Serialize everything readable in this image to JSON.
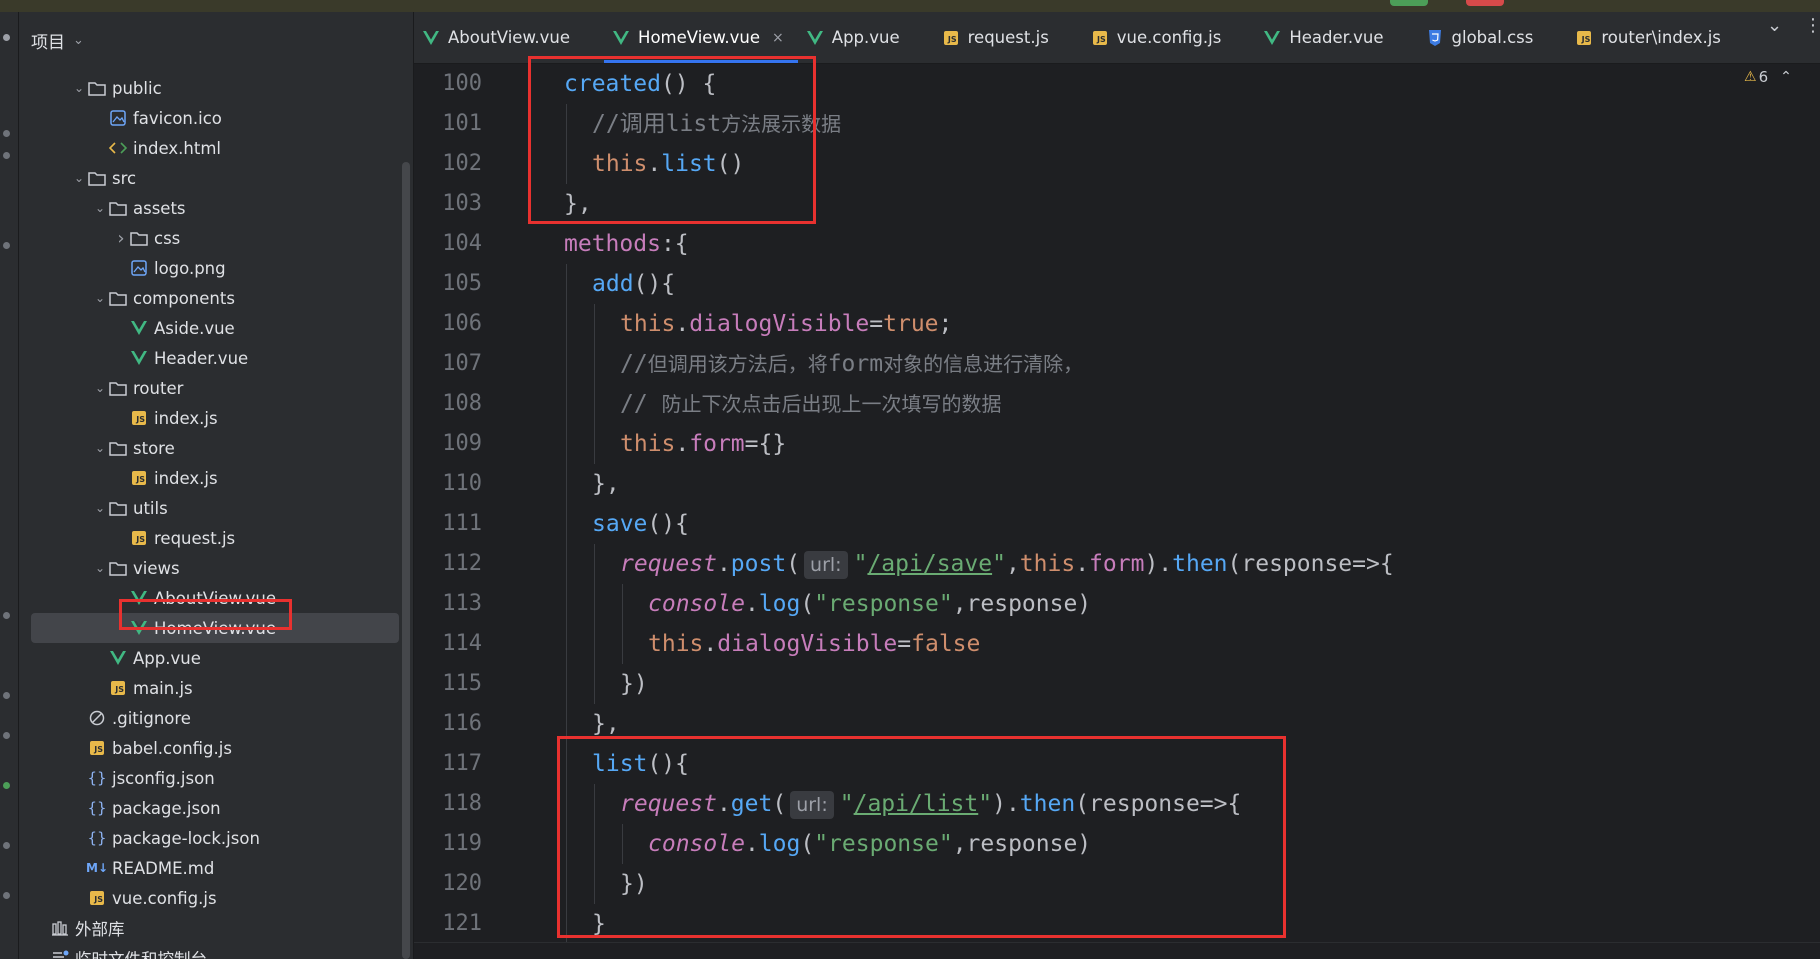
{
  "project": {
    "header_label": "项目",
    "tree": [
      {
        "label": "public",
        "type": "folder",
        "depth": 1,
        "expanded": true
      },
      {
        "label": "favicon.ico",
        "type": "image",
        "depth": 2
      },
      {
        "label": "index.html",
        "type": "html",
        "depth": 2
      },
      {
        "label": "src",
        "type": "folder",
        "depth": 1,
        "expanded": true
      },
      {
        "label": "assets",
        "type": "folder",
        "depth": 2,
        "expanded": true
      },
      {
        "label": "css",
        "type": "folder",
        "depth": 3,
        "expanded": false
      },
      {
        "label": "logo.png",
        "type": "image",
        "depth": 3
      },
      {
        "label": "components",
        "type": "folder",
        "depth": 2,
        "expanded": true
      },
      {
        "label": "Aside.vue",
        "type": "vue",
        "depth": 3
      },
      {
        "label": "Header.vue",
        "type": "vue",
        "depth": 3
      },
      {
        "label": "router",
        "type": "folder",
        "depth": 2,
        "expanded": true
      },
      {
        "label": "index.js",
        "type": "js",
        "depth": 3
      },
      {
        "label": "store",
        "type": "folder",
        "depth": 2,
        "expanded": true
      },
      {
        "label": "index.js",
        "type": "js",
        "depth": 3
      },
      {
        "label": "utils",
        "type": "folder",
        "depth": 2,
        "expanded": true
      },
      {
        "label": "request.js",
        "type": "js",
        "depth": 3
      },
      {
        "label": "views",
        "type": "folder",
        "depth": 2,
        "expanded": true
      },
      {
        "label": "AboutView.vue",
        "type": "vue",
        "depth": 3
      },
      {
        "label": "HomeView.vue",
        "type": "vue",
        "depth": 3,
        "selected": true
      },
      {
        "label": "App.vue",
        "type": "vue",
        "depth": 2
      },
      {
        "label": "main.js",
        "type": "js",
        "depth": 2
      },
      {
        "label": ".gitignore",
        "type": "ignore",
        "depth": 1
      },
      {
        "label": "babel.config.js",
        "type": "js",
        "depth": 1
      },
      {
        "label": "jsconfig.json",
        "type": "json",
        "depth": 1
      },
      {
        "label": "package.json",
        "type": "json",
        "depth": 1
      },
      {
        "label": "package-lock.json",
        "type": "json",
        "depth": 1
      },
      {
        "label": "README.md",
        "type": "md",
        "depth": 1
      },
      {
        "label": "vue.config.js",
        "type": "js",
        "depth": 1
      },
      {
        "label": "外部库",
        "type": "library",
        "depth": 0
      },
      {
        "label": "临时文件和控制台",
        "type": "scratch",
        "depth": 0
      }
    ]
  },
  "tabs": [
    {
      "label": "AboutView.vue",
      "type": "vue",
      "active": false
    },
    {
      "label": "HomeView.vue",
      "type": "vue",
      "active": true
    },
    {
      "label": "App.vue",
      "type": "vue",
      "active": false
    },
    {
      "label": "request.js",
      "type": "js",
      "active": false
    },
    {
      "label": "vue.config.js",
      "type": "js",
      "active": false
    },
    {
      "label": "Header.vue",
      "type": "vue",
      "active": false
    },
    {
      "label": "global.css",
      "type": "css",
      "active": false
    },
    {
      "label": "router\\index.js",
      "type": "js",
      "active": false
    }
  ],
  "editor": {
    "warnings_count": "6",
    "lines": [
      {
        "n": "100",
        "indent": 1,
        "tokens": [
          [
            "kw-fn",
            "created"
          ],
          [
            "punct",
            "() {"
          ]
        ]
      },
      {
        "n": "101",
        "indent": 2,
        "tokens": [
          [
            "comment",
            "//调用"
          ],
          [
            "comment",
            "list"
          ],
          [
            "comment cmt-cjk",
            "方法展示数据"
          ]
        ]
      },
      {
        "n": "102",
        "indent": 2,
        "tokens": [
          [
            "kw-this",
            "this"
          ],
          [
            "punct",
            "."
          ],
          [
            "kw-fn",
            "list"
          ],
          [
            "punct",
            "()"
          ]
        ]
      },
      {
        "n": "103",
        "indent": 1,
        "tokens": [
          [
            "punct",
            "},"
          ]
        ]
      },
      {
        "n": "104",
        "indent": 1,
        "tokens": [
          [
            "kw-prop",
            "methods"
          ],
          [
            "punct",
            ":{"
          ]
        ]
      },
      {
        "n": "105",
        "indent": 2,
        "tokens": [
          [
            "kw-fn",
            "add"
          ],
          [
            "punct",
            "(){"
          ]
        ]
      },
      {
        "n": "106",
        "indent": 3,
        "tokens": [
          [
            "kw-this",
            "this"
          ],
          [
            "punct",
            "."
          ],
          [
            "kw-prop",
            "dialogVisible"
          ],
          [
            "punct",
            "="
          ],
          [
            "kw-bool",
            "true"
          ],
          [
            "punct",
            ";"
          ]
        ]
      },
      {
        "n": "107",
        "indent": 3,
        "tokens": [
          [
            "comment",
            "//"
          ],
          [
            "comment cmt-cjk",
            "但调用该方法后，将"
          ],
          [
            "comment",
            "form"
          ],
          [
            "comment cmt-cjk",
            "对象的信息进行清除，"
          ]
        ]
      },
      {
        "n": "108",
        "indent": 3,
        "tokens": [
          [
            "comment",
            "// "
          ],
          [
            "comment cmt-cjk",
            "防止下次点击后出现上一次填写的数据"
          ]
        ]
      },
      {
        "n": "109",
        "indent": 3,
        "tokens": [
          [
            "kw-this",
            "this"
          ],
          [
            "punct",
            "."
          ],
          [
            "kw-prop",
            "form"
          ],
          [
            "punct",
            "={}"
          ]
        ]
      },
      {
        "n": "110",
        "indent": 2,
        "tokens": [
          [
            "punct",
            "},"
          ]
        ]
      },
      {
        "n": "111",
        "indent": 2,
        "tokens": [
          [
            "kw-fn",
            "save"
          ],
          [
            "punct",
            "(){"
          ]
        ]
      },
      {
        "n": "112",
        "indent": 3,
        "tokens": [
          [
            "kw-prop italic",
            "request"
          ],
          [
            "punct",
            "."
          ],
          [
            "kw-fn",
            "post"
          ],
          [
            "punct",
            "("
          ],
          [
            "hint",
            "url:"
          ],
          [
            "str",
            "\""
          ],
          [
            "str-link",
            "/api/save"
          ],
          [
            "str",
            "\""
          ],
          [
            "punct",
            ","
          ],
          [
            "kw-this",
            "this"
          ],
          [
            "punct",
            "."
          ],
          [
            "kw-prop",
            "form"
          ],
          [
            "punct",
            ")."
          ],
          [
            "kw-fn",
            "then"
          ],
          [
            "punct",
            "(response=>{"
          ]
        ]
      },
      {
        "n": "113",
        "indent": 4,
        "tokens": [
          [
            "kw-prop italic",
            "console"
          ],
          [
            "punct",
            "."
          ],
          [
            "kw-fn",
            "log"
          ],
          [
            "punct",
            "("
          ],
          [
            "str",
            "\"response\""
          ],
          [
            "punct",
            ",response)"
          ]
        ]
      },
      {
        "n": "114",
        "indent": 4,
        "tokens": [
          [
            "kw-this",
            "this"
          ],
          [
            "punct",
            "."
          ],
          [
            "kw-prop",
            "dialogVisible"
          ],
          [
            "punct",
            "="
          ],
          [
            "kw-bool",
            "false"
          ]
        ]
      },
      {
        "n": "115",
        "indent": 3,
        "tokens": [
          [
            "punct",
            "})"
          ]
        ]
      },
      {
        "n": "116",
        "indent": 2,
        "tokens": [
          [
            "punct",
            "},"
          ]
        ]
      },
      {
        "n": "117",
        "indent": 2,
        "tokens": [
          [
            "kw-fn",
            "list"
          ],
          [
            "punct",
            "(){"
          ]
        ]
      },
      {
        "n": "118",
        "indent": 3,
        "tokens": [
          [
            "kw-prop italic",
            "request"
          ],
          [
            "punct",
            "."
          ],
          [
            "kw-fn",
            "get"
          ],
          [
            "punct",
            "("
          ],
          [
            "hint",
            "url:"
          ],
          [
            "str",
            "\""
          ],
          [
            "str-link",
            "/api/list"
          ],
          [
            "str",
            "\""
          ],
          [
            "punct",
            ")."
          ],
          [
            "kw-fn",
            "then"
          ],
          [
            "punct",
            "(response=>{"
          ]
        ]
      },
      {
        "n": "119",
        "indent": 4,
        "tokens": [
          [
            "kw-prop italic",
            "console"
          ],
          [
            "punct",
            "."
          ],
          [
            "kw-fn",
            "log"
          ],
          [
            "punct",
            "("
          ],
          [
            "str",
            "\"response\""
          ],
          [
            "punct",
            ",response)"
          ]
        ]
      },
      {
        "n": "120",
        "indent": 3,
        "tokens": [
          [
            "punct",
            "})"
          ]
        ]
      },
      {
        "n": "121",
        "indent": 2,
        "tokens": [
          [
            "punct",
            "}"
          ]
        ]
      }
    ]
  },
  "colors": {
    "highlight_box": "#e8312f",
    "active_tab_underline": "#3574f0",
    "vue_icon": "#41b883",
    "js_icon": "#e8b94a",
    "css_icon": "#3d7ce3"
  }
}
